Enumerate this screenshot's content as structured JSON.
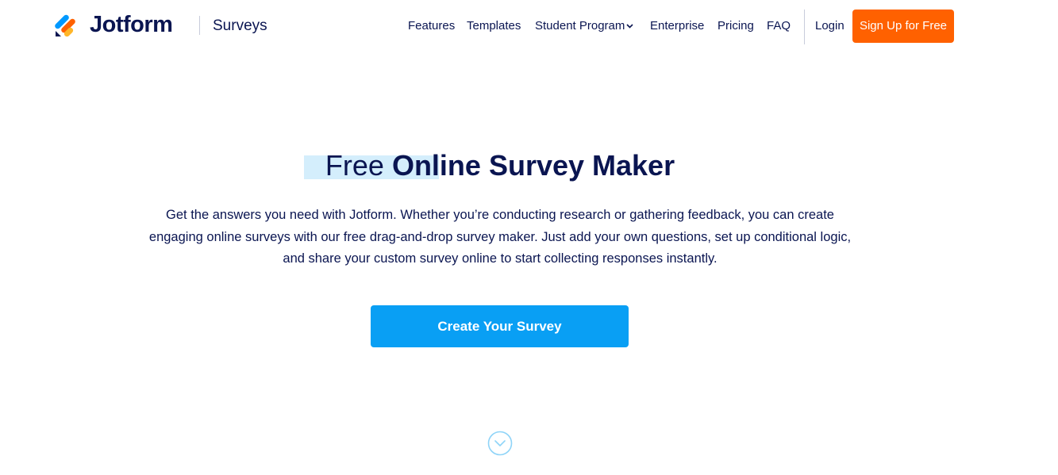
{
  "header": {
    "brand": "Jotform",
    "product": "Surveys",
    "nav": {
      "features": "Features",
      "templates": "Templates",
      "student_program": "Student Program",
      "enterprise": "Enterprise",
      "pricing": "Pricing",
      "faq": "FAQ",
      "login": "Login"
    },
    "signup_label": "Sign Up for Free"
  },
  "hero": {
    "title_light": "Free ",
    "title_bold": "Online Survey Maker",
    "description": "Get the answers you need with Jotform. Whether you’re conducting research or gathering feedback, you can create engaging online surveys with our free drag-and-drop survey maker. Just add your own questions, set up conditional logic, and share your custom survey online to start collecting responses instantly.",
    "cta_label": "Create Your Survey"
  },
  "icons": {
    "logo": "jotform-logo-icon",
    "nav_dropdown": "chevron-down-icon",
    "scroll": "circle-chevron-down-icon"
  },
  "colors": {
    "brand_navy": "#0a1551",
    "signup_orange": "#ff6100",
    "cta_blue": "#099ff4",
    "highlight": "#d4eefc",
    "scroll_icon": "#8fd4f8"
  }
}
